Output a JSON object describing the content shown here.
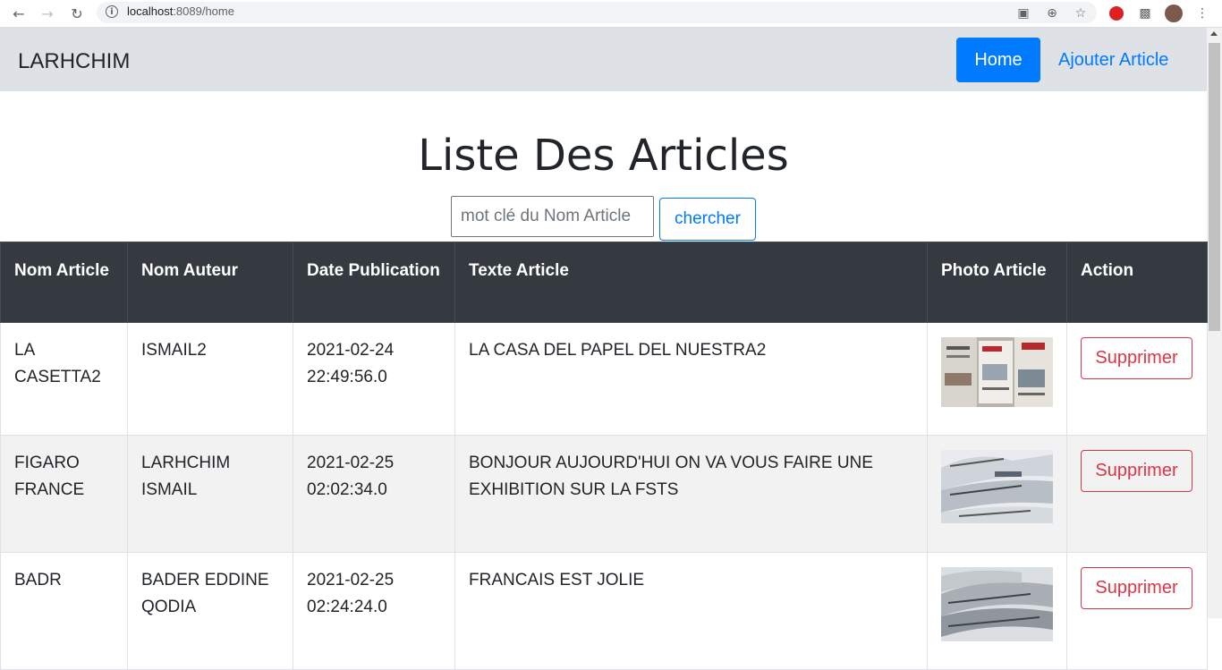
{
  "browser": {
    "url_host": "localhost",
    "url_rest": ":8089/home"
  },
  "navbar": {
    "brand": "LARHCHIM",
    "home_label": "Home",
    "add_label": "Ajouter Article"
  },
  "page": {
    "title": "Liste Des Articles",
    "search_placeholder": "mot clé du Nom Article",
    "search_button": "chercher"
  },
  "table": {
    "headers": [
      "Nom Article",
      "Nom Auteur",
      "Date Publication",
      "Texte Article",
      "Photo Article",
      "Action"
    ],
    "rows": [
      {
        "nom": "LA CASETTA2",
        "auteur": "ISMAIL2",
        "date": "2021-02-24 22:49:56.0",
        "texte": "LA CASA DEL PAPEL DEL NUESTRA2",
        "action": "Supprimer"
      },
      {
        "nom": "FIGARO FRANCE",
        "auteur": "LARHCHIM ISMAIL",
        "date": "2021-02-25 02:02:34.0",
        "texte": "BONJOUR AUJOURD'HUI ON VA VOUS FAIRE UNE EXHIBITION SUR LA FSTS",
        "action": "Supprimer"
      },
      {
        "nom": "BADR",
        "auteur": "BADER EDDINE QODIA",
        "date": "2021-02-25 02:24:24.0",
        "texte": "FRANCAIS EST JOLIE",
        "action": "Supprimer"
      }
    ]
  },
  "colors": {
    "primary": "#007bff",
    "danger": "#dc3545",
    "header_dark": "#343a40",
    "navbar_bg": "#dee1e6"
  }
}
